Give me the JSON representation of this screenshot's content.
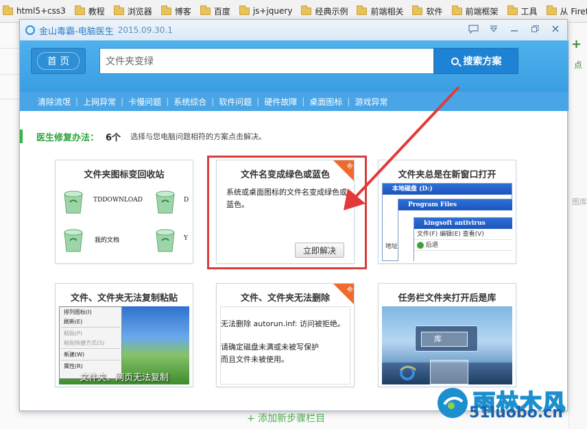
{
  "bookmarks": [
    "html5+css3",
    "教程",
    "浏览器",
    "博客",
    "百度",
    "js+jquery",
    "经典示例",
    "前端相关",
    "软件",
    "前端框架",
    "工具",
    "从 Firef"
  ],
  "background": {
    "plus": "+",
    "plus_label": "点",
    "side_label": "图库",
    "add_step": "+ 添加新步骤栏目"
  },
  "dialog": {
    "app_name": "金山毒霸-电脑医生",
    "version": "2015.09.30.1",
    "home_label": "首 页",
    "search_value": "文件夹变绿",
    "search_button": "搜索方案",
    "nav": [
      "清除流氓",
      "上网异常",
      "卡慢问题",
      "系统综合",
      "软件问题",
      "硬件故障",
      "桌面图标",
      "游戏异常"
    ],
    "tip_label": "医生修复办法：",
    "tip_count": "6个",
    "tip_desc": "选择与您电脑问题相符的方案点击解决。"
  },
  "cards": [
    {
      "title": "文件夹图标变回收站",
      "files": [
        "TDDOWNLOAD",
        "我的文档",
        "D",
        "Y"
      ]
    },
    {
      "title": "文件名变成绿色或蓝色",
      "desc": "系统或桌面图标的文件名变成绿色或蓝色。",
      "button": "立即解决",
      "badge": "新"
    },
    {
      "title": "文件夹总是在新窗口打开",
      "win1": "本地磁盘 (D:)",
      "win2": "Program Files",
      "win3": "kingsoft antivirus",
      "menu": [
        "文件(F)",
        "编辑(E)",
        "查看(V)"
      ],
      "addr": "地址",
      "back": "后退"
    },
    {
      "title": "文件、文件夹无法复制粘贴",
      "menu": [
        "排列图标(I)",
        "刷新(E)",
        "粘贴(P)",
        "粘贴快捷方式(S)",
        "新建(W)",
        "属性(R)"
      ],
      "caption": "文件夹、网页无法复制"
    },
    {
      "title": "文件、文件夹无法删除",
      "badge": "新",
      "line1": "无法删除  autorun.inf: 访问被拒绝。",
      "line2": "请确定磁盘未满或未被写保护",
      "line3": "而且文件未被使用。"
    },
    {
      "title": "任务栏文件夹打开后是库",
      "lib": "库"
    }
  ],
  "watermark": {
    "name": "雨林木风",
    "url": "51luobo.cn"
  },
  "colors": {
    "header": "#3ea3e6",
    "nav": "#49a5e6",
    "accent_green": "#2aa53a",
    "badge": "#ee6a2d",
    "highlight": "#d83b3b"
  }
}
